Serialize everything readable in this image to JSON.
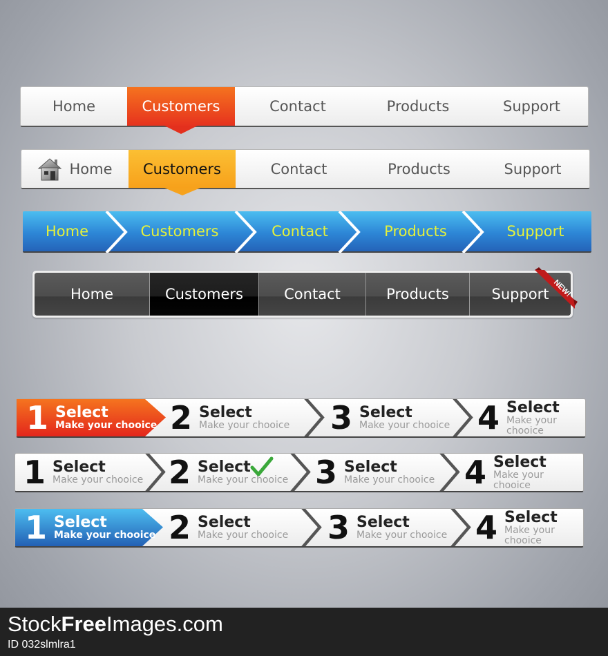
{
  "nav_bars": [
    {
      "style": "orange",
      "accent": "#e8381e",
      "active_index": 1,
      "items": [
        "Home",
        "Customers",
        "Contact",
        "Products",
        "Support"
      ]
    },
    {
      "style": "yellow",
      "accent": "#f8a91f",
      "active_index": 1,
      "home_icon": "house-icon",
      "items": [
        "Home",
        "Customers",
        "Contact",
        "Products",
        "Support"
      ]
    },
    {
      "style": "blue-arrows",
      "accent": "#2d86d6",
      "text_color": "#e6f23a",
      "items": [
        "Home",
        "Customers",
        "Contact",
        "Products",
        "Support"
      ]
    },
    {
      "style": "dark",
      "accent": "#000000",
      "active_index": 1,
      "items": [
        "Home",
        "Customers",
        "Contact",
        "Products",
        "Support"
      ],
      "badge": "NEW!"
    }
  ],
  "step_bars": [
    {
      "style": "orange",
      "accent": "#e8381e",
      "active_index": 0,
      "steps": [
        {
          "number": "1",
          "title": "Select",
          "subtitle": "Make your chooice"
        },
        {
          "number": "2",
          "title": "Select",
          "subtitle": "Make your chooice"
        },
        {
          "number": "3",
          "title": "Select",
          "subtitle": "Make your chooice"
        },
        {
          "number": "4",
          "title": "Select",
          "subtitle": "Make your chooice"
        }
      ]
    },
    {
      "style": "plain-checked",
      "checked_index": 1,
      "steps": [
        {
          "number": "1",
          "title": "Select",
          "subtitle": "Make your chooice"
        },
        {
          "number": "2",
          "title": "Select",
          "subtitle": "Make your chooice"
        },
        {
          "number": "3",
          "title": "Select",
          "subtitle": "Make your chooice"
        },
        {
          "number": "4",
          "title": "Select",
          "subtitle": "Make your chooice"
        }
      ]
    },
    {
      "style": "blue",
      "accent": "#2a7fd1",
      "active_index": 0,
      "steps": [
        {
          "number": "1",
          "title": "Select",
          "subtitle": "Make your chooice"
        },
        {
          "number": "2",
          "title": "Select",
          "subtitle": "Make your chooice"
        },
        {
          "number": "3",
          "title": "Select",
          "subtitle": "Make your chooice"
        },
        {
          "number": "4",
          "title": "Select",
          "subtitle": "Make your chooice"
        }
      ]
    }
  ],
  "footer": {
    "brand_pre": "Stock",
    "brand_bold": "Free",
    "brand_post": "Images.com",
    "id_text": "ID 032slmlra1"
  }
}
